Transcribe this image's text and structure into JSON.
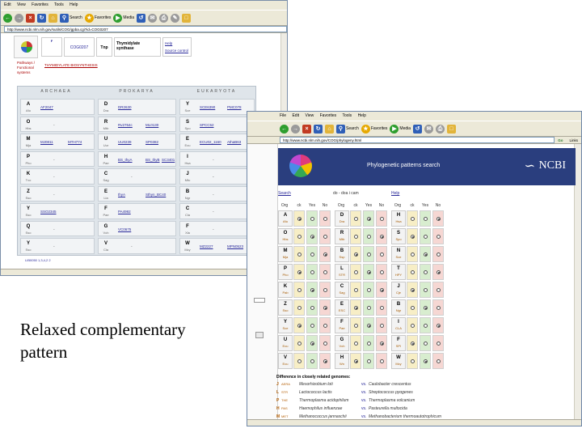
{
  "window1": {
    "menu": [
      "Edit",
      "View",
      "Favorites",
      "Tools",
      "Help"
    ],
    "toolbar": {
      "search": "Search",
      "favorites": "Favorites",
      "media": "Media"
    },
    "address": "http://www.ncbi.nlm.nih.gov/sutils/COG/gpba.cgi?id=COG0207",
    "header": {
      "cog_id": "COG0207",
      "category": "F",
      "category_word": "Tnp",
      "title": "Thymidylate synthase",
      "links": [
        "Help",
        "Source control"
      ],
      "pathway_label": "Pathways / Functional systems",
      "pathway_value": "THYMIDYLATE BIOSYNTHESIS"
    },
    "columns": [
      "ARCHAEA",
      "PROKARYA",
      "EUKARYOTA"
    ],
    "rows": [
      {
        "a_letter": "A",
        "a_sub": "Afu",
        "a_val": "AF2047",
        "b_letter": "D",
        "b_sub": "Dra",
        "b_val": "DR2630",
        "c_letter": "Y",
        "c_sub": "Sce",
        "c_val": "SCE6390",
        "c_val2": "PMC078"
      },
      {
        "a_letter": "O",
        "a_sub": "Hbs",
        "a_val": "-",
        "b_letter": "R",
        "b_sub": "Mtb",
        "b_val": "Rv2764c",
        "b_val2": "ML0130",
        "c_letter": "S",
        "c_sub": "Spo",
        "c_val": "SPCC52"
      },
      {
        "a_letter": "M",
        "a_sub": "Mja",
        "a_val": "MJ0811",
        "a_val2": "MTH774",
        "b_letter": "U",
        "b_sub": "Uur",
        "b_val": "UU0239",
        "b_val2": "SP0382",
        "c_letter": "E",
        "c_sub": "Ecu",
        "c_val": "ECU02_1160",
        "c_val2": "AthaB63"
      },
      {
        "a_letter": "P",
        "a_sub": "Pho",
        "a_val": "-",
        "b_letter": "H",
        "b_sub": "Pae",
        "b_val": "BS_thyA",
        "b_val2": "BS_thyB",
        "b_val3": "SC3401",
        "c_letter": "I",
        "c_sub": "Hsa",
        "c_val": "-"
      },
      {
        "a_letter": "K",
        "a_sub": "Tvo",
        "a_val": "-",
        "b_letter": "C",
        "b_sub": "Sag",
        "b_val": "-",
        "c_letter": "J",
        "c_sub": "Mtu",
        "c_val": "-",
        "c_val2": "-"
      },
      {
        "a_letter": "Z",
        "a_sub": "Sso",
        "a_val": "-",
        "b_letter": "E",
        "b_sub": "Lla",
        "b_val": "thyA",
        "b_val2": "Sthyn_BC40",
        "c_letter": "B",
        "c_sub": "Ngr",
        "c_val": "-"
      },
      {
        "a_letter": "Y",
        "a_sub": "Sso",
        "a_val": "SSO2345",
        "b_letter": "F",
        "b_sub": "Pae",
        "b_val": "PA4992",
        "c_letter": "C",
        "c_sub": "Cla",
        "c_val": "-"
      },
      {
        "a_letter": "Q",
        "a_sub": "Sso",
        "a_val": "-",
        "b_letter": "G",
        "b_sub": "Vch",
        "b_val": "VC0675",
        "c_letter": "F",
        "c_sub": "Xla",
        "c_val": "-"
      },
      {
        "a_letter": "Y",
        "a_sub": "Sso",
        "a_val": "-",
        "b_letter": "V",
        "b_sub": "Cla",
        "b_val": "-",
        "c_letter": "W",
        "c_sub": "Mcy",
        "c_val": "MZ2227",
        "c_val2": "MPN0523"
      }
    ],
    "footer_legend": "LIB0050 1,3,4,2 2"
  },
  "window2": {
    "menu": [
      "File",
      "Edit",
      "View",
      "Favorites",
      "Tools",
      "Help"
    ],
    "toolbar": {
      "search": "Search",
      "favorites": "Favorites",
      "media": "Media"
    },
    "address": "http://www.ncbi.nlm.nih.gov/COG/phylogeny.html",
    "go": "Go",
    "links": "Links",
    "banner_title": "Phylogenetic patterns search",
    "banner_logo": "NCBI",
    "search_button": "Search",
    "clear_text": "do - doa i cam",
    "help_link": "Help",
    "header_codes": [
      "Org",
      "ck",
      "Yes",
      "No",
      "Org",
      "ck",
      "Yes",
      "No",
      "Org",
      "ck",
      "Yes",
      "No"
    ],
    "rows_left": [
      [
        "A",
        "Afu"
      ],
      [
        "O",
        "Hbs"
      ],
      [
        "M",
        "Mja"
      ],
      [
        "P",
        "Pho"
      ],
      [
        "K",
        "Pab"
      ],
      [
        "Z",
        "Sso"
      ],
      [
        "Y",
        "Sce"
      ],
      [
        "U",
        "Ecu"
      ],
      [
        "V",
        "Ecu"
      ]
    ],
    "rows_mid": [
      [
        "D",
        "Dra"
      ],
      [
        "R",
        "Mtb"
      ],
      [
        "B",
        "Ssp"
      ],
      [
        "L",
        "STR"
      ],
      [
        "C",
        "Sag"
      ],
      [
        "E",
        "ESC"
      ],
      [
        "F",
        "Pae"
      ],
      [
        "G",
        "Vch"
      ],
      [
        "H",
        "Wn"
      ]
    ],
    "rows_right": [
      [
        "H",
        "Hsa"
      ],
      [
        "S",
        "Spo"
      ],
      [
        "N",
        "Sce"
      ],
      [
        "T",
        "HPY"
      ],
      [
        "J",
        "Cje"
      ],
      [
        "B",
        "Ngr"
      ],
      [
        "I",
        "CLA"
      ],
      [
        "F",
        "SPI"
      ],
      [
        "W",
        "Mcy"
      ]
    ],
    "diff_title": "Difference in closely related genomes:",
    "diff_rows": [
      {
        "code": "J",
        "sub": "AERA",
        "left": "Mesorhizobium loti",
        "mid": "vs.",
        "right": "Caulobacter crescentus"
      },
      {
        "code": "L",
        "sub": "STR",
        "left": "Lactococcus lactis",
        "mid": "vs.",
        "right": "Streptococcus pyogenes"
      },
      {
        "code": "P",
        "sub": "THE",
        "left": "Thermoplasma acidophilum",
        "mid": "vs.",
        "right": "Thermoplasma volcanium"
      },
      {
        "code": "H",
        "sub": "PAS",
        "left": "Haemophilus influenzae",
        "mid": "vs.",
        "right": "Pasteurella multocida"
      },
      {
        "code": "M",
        "sub": "MET",
        "left": "Methanococcus jannaschii",
        "mid": "vs.",
        "right": "Methanobacterium thermoautotrophicum"
      }
    ]
  },
  "caption": {
    "line1": "Relaxed complementary",
    "line2": "pattern"
  }
}
